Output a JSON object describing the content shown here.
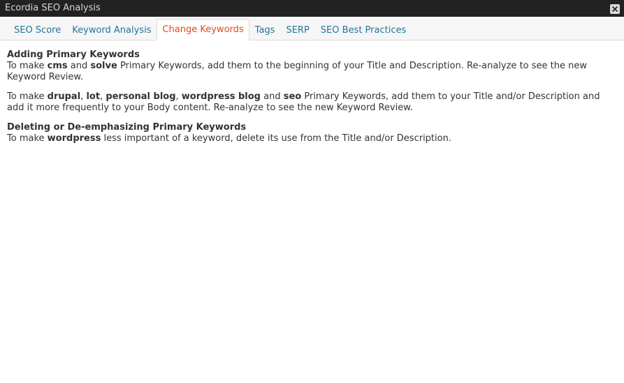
{
  "window": {
    "title": "Ecordia SEO Analysis",
    "close_symbol": "✕"
  },
  "tabs": [
    {
      "label": "SEO Score",
      "active": false
    },
    {
      "label": "Keyword Analysis",
      "active": false
    },
    {
      "label": "Change Keywords",
      "active": true
    },
    {
      "label": "Tags",
      "active": false
    },
    {
      "label": "SERP",
      "active": false
    },
    {
      "label": "SEO Best Practices",
      "active": false
    }
  ],
  "sections": {
    "adding": {
      "heading": "Adding Primary Keywords",
      "p1": {
        "t1": "To make ",
        "k1": "cms",
        "t2": " and ",
        "k2": "solve",
        "t3": " Primary Keywords, add them to the beginning of your Title and Description. Re-analyze to see the new Keyword Review."
      },
      "p2": {
        "t1": "To make ",
        "k1": "drupal",
        "s1": ", ",
        "k2": "lot",
        "s2": ", ",
        "k3": "personal blog",
        "s3": ", ",
        "k4": "wordpress blog",
        "t2": " and ",
        "k5": "seo",
        "t3": " Primary Keywords, add them to your Title and/or Description and add it more frequently to your Body content. Re-analyze to see the new Keyword Review."
      }
    },
    "deleting": {
      "heading": "Deleting or De-emphasizing Primary Keywords",
      "p1": {
        "t1": "To make ",
        "k1": "wordpress",
        "t2": " less important of a keyword, delete its use from the Title and/or Description."
      }
    }
  },
  "colors": {
    "titlebar_bg": "#222222",
    "tab_link": "#21759b",
    "tab_active": "#d54e21"
  }
}
